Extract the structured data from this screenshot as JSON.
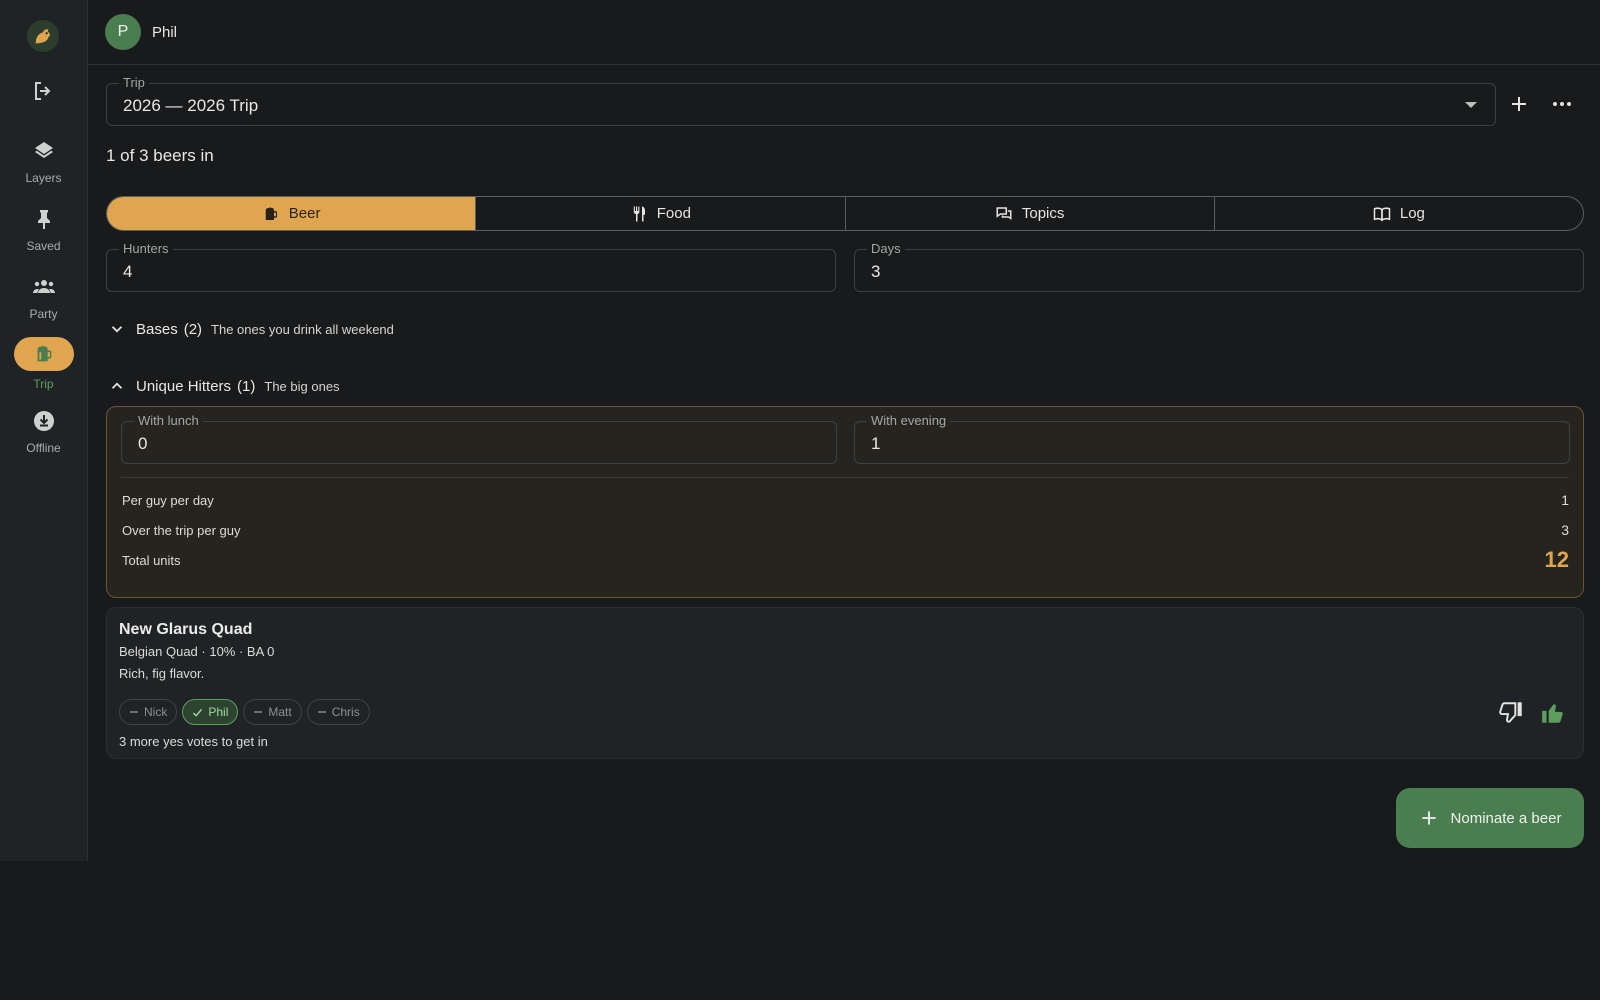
{
  "nav": {
    "items": [
      {
        "label": "Layers",
        "icon": "layers-icon"
      },
      {
        "label": "Saved",
        "icon": "pin-icon"
      },
      {
        "label": "Party",
        "icon": "group-icon"
      },
      {
        "label": "Trip",
        "icon": "beer-mug-icon",
        "active": true
      },
      {
        "label": "Offline",
        "icon": "download-icon"
      }
    ]
  },
  "user": {
    "initial": "P",
    "name": "Phil"
  },
  "trip": {
    "label": "Trip",
    "value": "2026 — 2026 Trip"
  },
  "status": {
    "beers_in": "1 of 3 beers in"
  },
  "tabs": [
    {
      "label": "Beer",
      "icon": "beer-mug-icon",
      "active": true
    },
    {
      "label": "Food",
      "icon": "utensils-icon"
    },
    {
      "label": "Topics",
      "icon": "chat-icon"
    },
    {
      "label": "Log",
      "icon": "book-icon"
    }
  ],
  "params": {
    "hunters": {
      "label": "Hunters",
      "value": "4"
    },
    "days": {
      "label": "Days",
      "value": "3"
    }
  },
  "groups": {
    "bases": {
      "title": "Bases",
      "count": "(2)",
      "subtitle": "The ones you drink all weekend",
      "expanded": false
    },
    "unique": {
      "title": "Unique Hitters",
      "count": "(1)",
      "subtitle": "The big ones",
      "expanded": true,
      "with_lunch": {
        "label": "With lunch",
        "value": "0"
      },
      "with_evening": {
        "label": "With evening",
        "value": "1"
      },
      "per_guy_per_day": {
        "label": "Per guy per day",
        "value": "1"
      },
      "over_trip": {
        "label": "Over the trip per guy",
        "value": "3"
      },
      "total_units": {
        "label": "Total units",
        "value": "12"
      }
    }
  },
  "beer": {
    "name": "New Glarus Quad",
    "meta": "Belgian Quad · 10% · BA 0",
    "description": "Rich, fig flavor.",
    "votes": [
      {
        "name": "Nick",
        "state": "none"
      },
      {
        "name": "Phil",
        "state": "yes"
      },
      {
        "name": "Matt",
        "state": "none"
      },
      {
        "name": "Chris",
        "state": "none"
      }
    ],
    "needed": "3 more yes votes to get in"
  },
  "fab": {
    "label": "Nominate a beer"
  },
  "colors": {
    "accent": "#e0a64f",
    "green": "#4a7d4f",
    "background": "#191a1c",
    "rail": "#1f2326"
  }
}
